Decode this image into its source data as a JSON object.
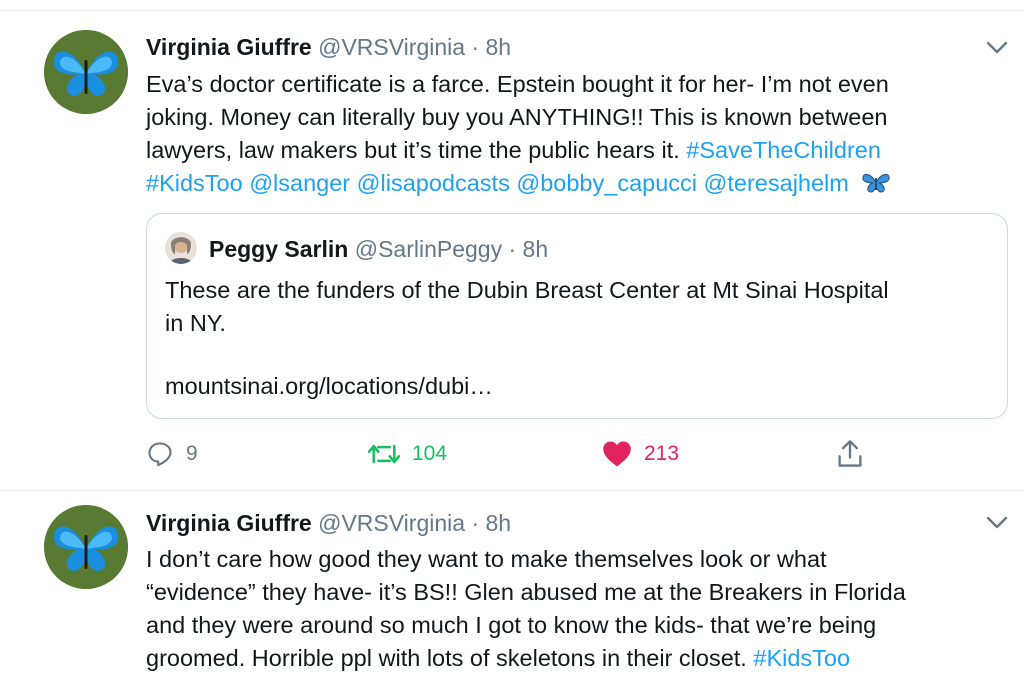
{
  "tweets": [
    {
      "author": "Virginia Giuffre",
      "handle": "@VRSVirginia",
      "time": "· 8h",
      "text_lines": [
        [
          {
            "t": "Eva’s doctor certificate is a farce. Epstein bought it for her- I’m not even",
            "link": false
          }
        ],
        [
          {
            "t": "joking. Money can literally buy you ANYTHING!! This is known between",
            "link": false
          }
        ],
        [
          {
            "t": "lawyers, law makers but it’s time the public hears it. ",
            "link": false
          },
          {
            "t": "#SaveTheChildren",
            "link": true
          }
        ],
        [
          {
            "t": "#KidsToo @lsanger @lisapodcasts @bobby_capucci @teresajhelm",
            "link": true
          }
        ]
      ],
      "quote": {
        "author": "Peggy Sarlin",
        "handle": "@SarlinPeggy",
        "time": "· 8h",
        "text_line1": "These are the funders of the Dubin Breast Center at Mt Sinai Hospital",
        "text_line2": "in NY.",
        "url": "mountsinai.org/locations/dubi…"
      },
      "actions": {
        "replies": "9",
        "retweets": "104",
        "likes": "213"
      }
    },
    {
      "author": "Virginia Giuffre",
      "handle": "@VRSVirginia",
      "time": "· 8h",
      "text_lines": [
        [
          {
            "t": "I don’t care how good they want to make themselves look or what",
            "link": false
          }
        ],
        [
          {
            "t": "“evidence” they have- it’s BS!! Glen abused me at the Breakers in Florida",
            "link": false
          }
        ],
        [
          {
            "t": "and they were around so much I got to know the kids- that we’re being",
            "link": false
          }
        ],
        [
          {
            "t": "groomed. Horrible ppl with lots of skeletons in their closet. ",
            "link": false
          },
          {
            "t": "#KidsToo",
            "link": true
          }
        ]
      ]
    }
  ],
  "colors": {
    "link": "#1da1f2",
    "retweet": "#17bf63",
    "like": "#e0245e",
    "muted": "#657786",
    "divider": "#e6ecf0"
  },
  "icons": [
    "butterfly-avatar",
    "chevron-down-icon",
    "butterfly-emoji-icon",
    "reply-icon",
    "retweet-icon",
    "heart-icon",
    "share-icon"
  ]
}
